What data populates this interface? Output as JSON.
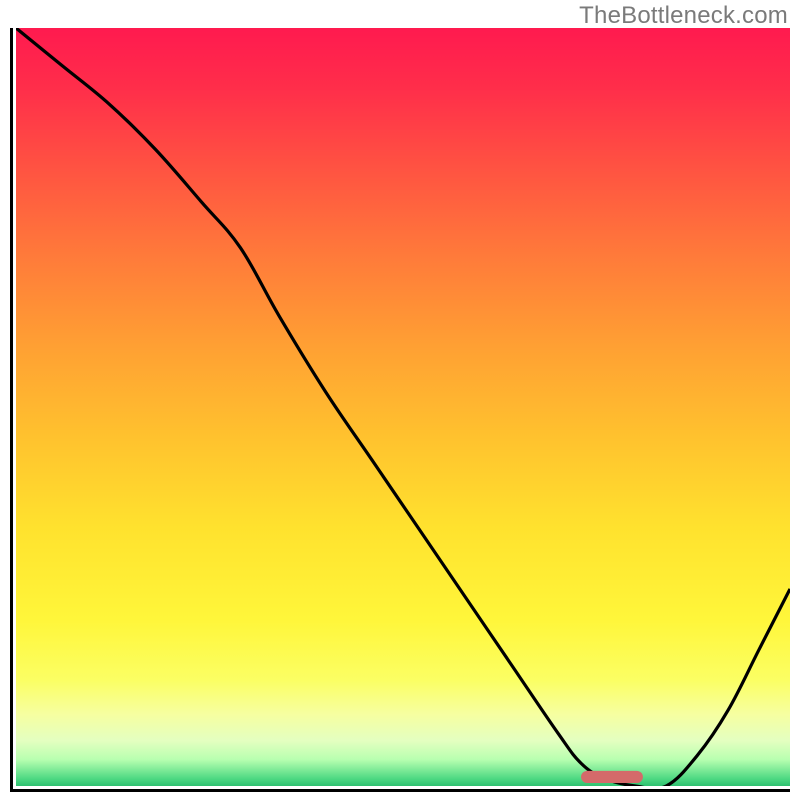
{
  "watermark": "TheBottleneck.com",
  "chart_data": {
    "type": "line",
    "title": "",
    "xlabel": "",
    "ylabel": "",
    "xlim": [
      0,
      100
    ],
    "ylim": [
      0,
      100
    ],
    "grid": false,
    "legend": false,
    "background": {
      "type": "vertical_gradient",
      "stops": [
        {
          "offset": 0.0,
          "color": "#ff1a4f"
        },
        {
          "offset": 0.08,
          "color": "#ff2e4a"
        },
        {
          "offset": 0.18,
          "color": "#ff5142"
        },
        {
          "offset": 0.3,
          "color": "#ff7a3a"
        },
        {
          "offset": 0.42,
          "color": "#ffa033"
        },
        {
          "offset": 0.54,
          "color": "#ffc22e"
        },
        {
          "offset": 0.66,
          "color": "#ffe22e"
        },
        {
          "offset": 0.78,
          "color": "#fff63a"
        },
        {
          "offset": 0.86,
          "color": "#fbff63"
        },
        {
          "offset": 0.905,
          "color": "#f6ffa0"
        },
        {
          "offset": 0.94,
          "color": "#e4ffc0"
        },
        {
          "offset": 0.965,
          "color": "#b8ffb0"
        },
        {
          "offset": 0.99,
          "color": "#4fd983"
        },
        {
          "offset": 1.0,
          "color": "#2dc06f"
        }
      ]
    },
    "series": [
      {
        "name": "bottleneck-curve",
        "color": "#000000",
        "x": [
          0,
          6,
          12,
          18,
          24,
          29,
          34,
          40,
          46,
          52,
          58,
          64,
          70,
          73,
          76,
          80,
          84,
          88,
          92,
          96,
          100
        ],
        "y": [
          100,
          95,
          90,
          84,
          77,
          71,
          62,
          52,
          43,
          34,
          25,
          16,
          7,
          3,
          1,
          0,
          0,
          4,
          10,
          18,
          26
        ]
      }
    ],
    "markers": [
      {
        "name": "optimal-marker",
        "shape": "rounded-rect",
        "x": 77,
        "y": 1.2,
        "width_pct": 8,
        "height_pct": 1.6,
        "color": "#d46a6a"
      }
    ]
  }
}
